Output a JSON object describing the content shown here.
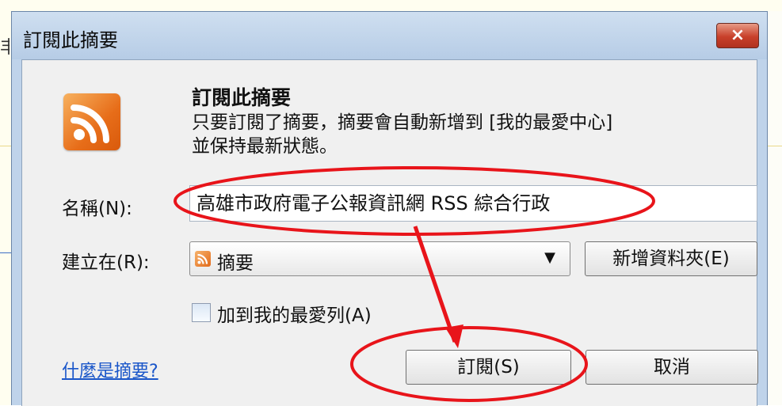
{
  "dialog": {
    "title": "訂閱此摘要",
    "close_label": "×",
    "heading": "訂閱此摘要",
    "description_line1": "只要訂閱了摘要，摘要會自動新增到 [我的最愛中心]",
    "description_line2": "並保持最新狀態。",
    "name_label": "名稱(N):",
    "name_value": "高雄市政府電子公報資訊網 RSS 綜合行政",
    "create_in_label": "建立在(R):",
    "create_in_value": "摘要",
    "new_folder_button": "新增資料夾(E)",
    "favorites_bar_checkbox_label": "加到我的最愛列(A)",
    "favorites_bar_checked": false,
    "help_link": "什麼是摘要?",
    "subscribe_button": "訂閱(S)",
    "cancel_button": "取消"
  },
  "background": {
    "left_edge_char": "丰"
  },
  "colors": {
    "annotation_red": "#e8141a",
    "rss_orange": "#e76d19",
    "link_blue": "#1a56c9"
  },
  "icons": {
    "rss": "rss-feed-icon",
    "close": "close-icon",
    "dropdown": "chevron-down-icon"
  }
}
